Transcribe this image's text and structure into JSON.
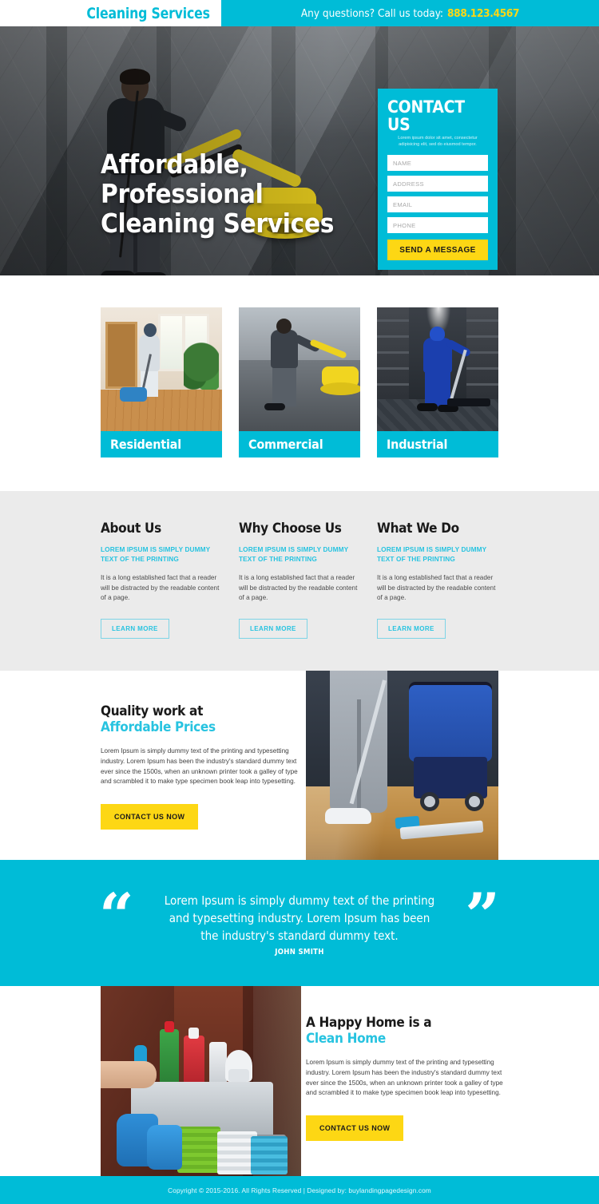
{
  "header": {
    "logo": "Cleaning Services",
    "question_text": "Any questions? Call us today:",
    "phone": "888.123.4567"
  },
  "hero": {
    "title_line1": "Affordable, Professional",
    "title_line2": "Cleaning Services"
  },
  "contact_form": {
    "title": "CONTACT US",
    "subtitle": "Lorem ipsum dolor sit amet, consectetur adipisicing elit, sed do eiusmod tempor.",
    "fields": [
      {
        "name": "name",
        "placeholder": "NAME",
        "value": ""
      },
      {
        "name": "address",
        "placeholder": "ADDRESS",
        "value": ""
      },
      {
        "name": "email",
        "placeholder": "EMAIL",
        "value": ""
      },
      {
        "name": "phone",
        "placeholder": "PHONE",
        "value": ""
      }
    ],
    "submit_label": "SEND A MESSAGE"
  },
  "services": [
    {
      "label": "Residential"
    },
    {
      "label": "Commercial"
    },
    {
      "label": "Industrial"
    }
  ],
  "features": [
    {
      "title": "About Us",
      "subtitle": "LOREM IPSUM IS SIMPLY DUMMY TEXT OF THE PRINTING",
      "body": "It is a long established fact that a reader will be distracted by the readable content of a page.",
      "button": "LEARN MORE"
    },
    {
      "title": "Why Choose Us",
      "subtitle": "LOREM IPSUM IS SIMPLY DUMMY TEXT OF THE PRINTING",
      "body": "It is a long established fact that a reader will be distracted by the readable content of a page.",
      "button": "LEARN MORE"
    },
    {
      "title": "What We Do",
      "subtitle": "LOREM IPSUM IS SIMPLY DUMMY TEXT OF THE PRINTING",
      "body": "It is a long established fact that a reader will be distracted by the readable content of a page.",
      "button": "LEARN MORE"
    }
  ],
  "quality": {
    "title_line1": "Quality work at",
    "title_line2": "Affordable Prices",
    "body": "Lorem Ipsum is simply dummy text of the printing and typesetting industry. Lorem Ipsum has been the industry's standard dummy text ever since the 1500s, when an unknown printer took a galley of type and scrambled it to make  type specimen book leap into typesetting.",
    "button": "CONTACT US NOW"
  },
  "testimonial": {
    "quote_open": "“",
    "quote_close": "”",
    "text": "Lorem Ipsum is simply dummy text of the printing and typesetting industry. Lorem Ipsum has been the industry's standard dummy text.",
    "author": "JOHN SMITH"
  },
  "happy_home": {
    "title_line1": "A Happy Home is a",
    "title_line2": "Clean Home",
    "body": "Lorem Ipsum is simply dummy text of the printing and typesetting industry. Lorem Ipsum has been the industry's standard dummy text ever since the 1500s, when an unknown printer took a galley of type and scrambled it to make  type specimen book leap into typesetting.",
    "button": "CONTACT US NOW"
  },
  "footer": {
    "text": "Copyright © 2015-2016. All Rights Reserved  |  Designed by: buylandingpagedesign.com"
  },
  "colors": {
    "brand_cyan": "#00bcd7",
    "accent_yellow": "#fdd714",
    "link_cyan": "#27c3e0",
    "section_gray": "#ebebeb"
  }
}
